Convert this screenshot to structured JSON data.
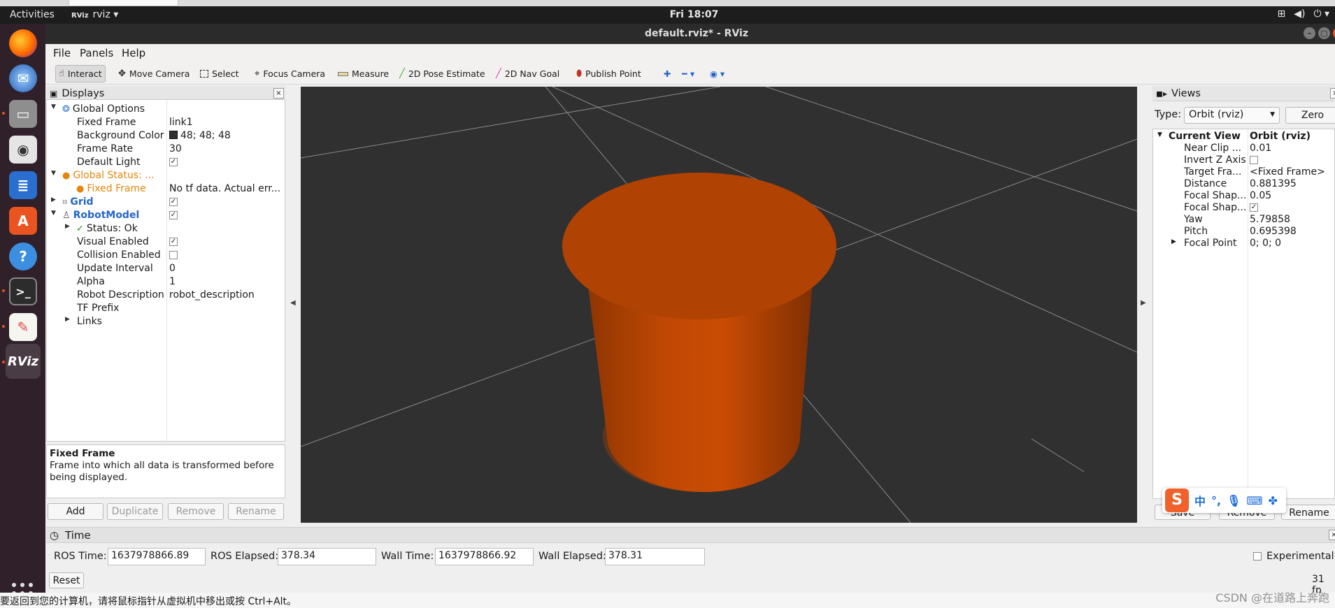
{
  "top_bar": {
    "activities": "Activities",
    "app_badge": "RViz",
    "app_name": "rviz",
    "clock": "Fri 18:07"
  },
  "dock": {
    "items": [
      "firefox-icon",
      "thunderbird-icon",
      "files-icon",
      "rhythmbox-icon",
      "libreoffice-writer-icon",
      "ubuntu-software-icon",
      "help-icon",
      "terminal-icon",
      "text-editor-icon",
      "rviz-icon"
    ],
    "rviz_label": "RViz"
  },
  "window": {
    "title": "default.rviz* - RViz"
  },
  "menu": [
    "File",
    "Panels",
    "Help"
  ],
  "toolbar": {
    "tools": [
      "Interact",
      "Move Camera",
      "Select",
      "Focus Camera",
      "Measure",
      "2D Pose Estimate",
      "2D Nav Goal",
      "Publish Point"
    ]
  },
  "displays": {
    "title": "Displays",
    "rows": [
      {
        "label": "Global Options",
        "value": ""
      },
      {
        "label": "Fixed Frame",
        "value": "link1"
      },
      {
        "label": "Background Color",
        "value": "48; 48; 48"
      },
      {
        "label": "Frame Rate",
        "value": "30"
      },
      {
        "label": "Default Light",
        "value": ""
      },
      {
        "label": "Global Status: ...",
        "value": ""
      },
      {
        "label": "Fixed Frame",
        "value": "No tf data.  Actual err..."
      },
      {
        "label": "Grid",
        "value": ""
      },
      {
        "label": "RobotModel",
        "value": ""
      },
      {
        "label": "Status: Ok",
        "value": ""
      },
      {
        "label": "Visual Enabled",
        "value": ""
      },
      {
        "label": "Collision Enabled",
        "value": ""
      },
      {
        "label": "Update Interval",
        "value": "0"
      },
      {
        "label": "Alpha",
        "value": "1"
      },
      {
        "label": "Robot Description",
        "value": "robot_description"
      },
      {
        "label": "TF Prefix",
        "value": ""
      },
      {
        "label": "Links",
        "value": ""
      }
    ],
    "help_title": "Fixed Frame",
    "help_text": "Frame into which all data is transformed before being displayed.",
    "buttons": [
      "Add",
      "Duplicate",
      "Remove",
      "Rename"
    ]
  },
  "views": {
    "title": "Views",
    "type_label": "Type:",
    "type_value": "Orbit (rviz)",
    "zero_label": "Zero",
    "rows": [
      {
        "label": "Current View",
        "value": "Orbit (rviz)"
      },
      {
        "label": "Near Clip ...",
        "value": "0.01"
      },
      {
        "label": "Invert Z Axis",
        "value": ""
      },
      {
        "label": "Target Fra...",
        "value": "<Fixed Frame>"
      },
      {
        "label": "Distance",
        "value": "0.881395"
      },
      {
        "label": "Focal Shap...",
        "value": "0.05"
      },
      {
        "label": "Focal Shap...",
        "value": ""
      },
      {
        "label": "Yaw",
        "value": "5.79858"
      },
      {
        "label": "Pitch",
        "value": "0.695398"
      },
      {
        "label": "Focal Point",
        "value": "0; 0; 0"
      }
    ],
    "buttons": [
      "Save",
      "Remove",
      "Rename"
    ]
  },
  "time": {
    "title": "Time",
    "ros_time_label": "ROS Time:",
    "ros_time": "1637978866.89",
    "ros_elapsed_label": "ROS Elapsed:",
    "ros_elapsed": "378.34",
    "wall_time_label": "Wall Time:",
    "wall_time": "1637978866.92",
    "wall_elapsed_label": "Wall Elapsed:",
    "wall_elapsed": "378.31",
    "experimental_label": "Experimental",
    "reset_label": "Reset",
    "fps": "31 fp"
  },
  "status_message": "要返回到您的计算机，请将鼠标指针从虚拟机中移出或按 Ctrl+Alt。",
  "ime": {
    "lang": "中",
    "punct": "°,"
  },
  "watermark": "CSDN @在道路上奔跑",
  "colors": {
    "accent": "#e95420",
    "viewport_bg": "#303030",
    "model": "#c84a05"
  }
}
